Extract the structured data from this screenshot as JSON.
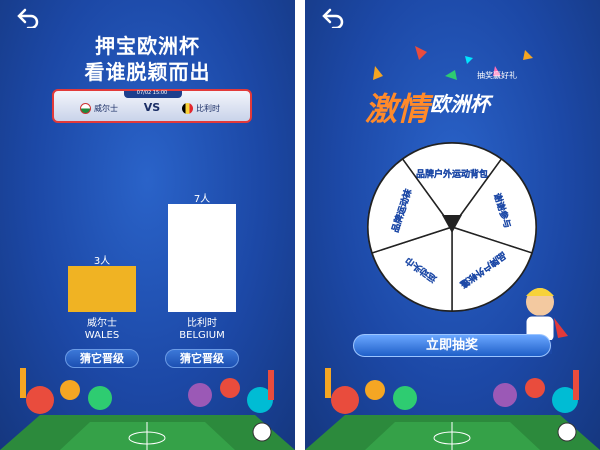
{
  "left": {
    "back_icon": "back-arrow-icon",
    "title_line1": "押宝欧洲杯",
    "title_line2": "看谁脱颖而出",
    "match": {
      "time": "07/02 15:00",
      "home_team": "威尔士",
      "away_team": "比利时",
      "vs": "VS"
    },
    "votes": {
      "home_count_label": "3人",
      "away_count_label": "7人",
      "home_value": 3,
      "away_value": 7,
      "home_color": "#f0b323",
      "away_color": "#ffffff"
    },
    "teams": [
      {
        "cn": "威尔士",
        "en": "WALES",
        "button": "猜它晋级"
      },
      {
        "cn": "比利时",
        "en": "BELGIUM",
        "button": "猜它晋级"
      }
    ]
  },
  "right": {
    "back_icon": "back-arrow-icon",
    "logo_main": "激情",
    "logo_sub": "欧洲杯",
    "logo_tag": "抽奖赢好礼",
    "wheel_segments": [
      "品牌户外运动背包",
      "谢谢参与",
      "品牌户外帐篷",
      "运动头巾",
      "品牌运动袜"
    ],
    "draw_button": "立即抽奖"
  }
}
